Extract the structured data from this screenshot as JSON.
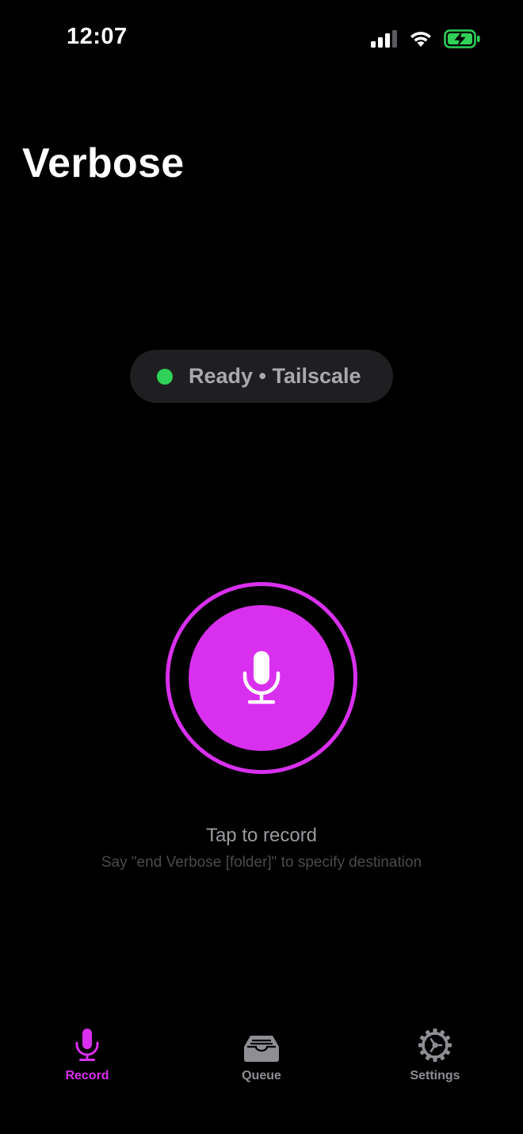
{
  "status_bar": {
    "time": "12:07",
    "icons": [
      "cellular-signal-icon",
      "wifi-icon",
      "battery-charging-icon"
    ]
  },
  "header": {
    "title": "Verbose"
  },
  "connection": {
    "status_label": "Ready • Tailscale",
    "dot_color": "#30d158"
  },
  "record": {
    "icon": "microphone-icon",
    "accent_color": "#d930ef",
    "hint": "Tap to record",
    "subhint": "Say \"end Verbose [folder]\" to specify destination"
  },
  "tabs": [
    {
      "label": "Record",
      "icon": "microphone-icon",
      "active": true
    },
    {
      "label": "Queue",
      "icon": "tray-icon",
      "active": false
    },
    {
      "label": "Settings",
      "icon": "gear-icon",
      "active": false
    }
  ],
  "colors": {
    "background": "#000000",
    "accent": "#d930ef",
    "inactive_tab": "#8e8e93",
    "battery_green": "#30d158"
  }
}
